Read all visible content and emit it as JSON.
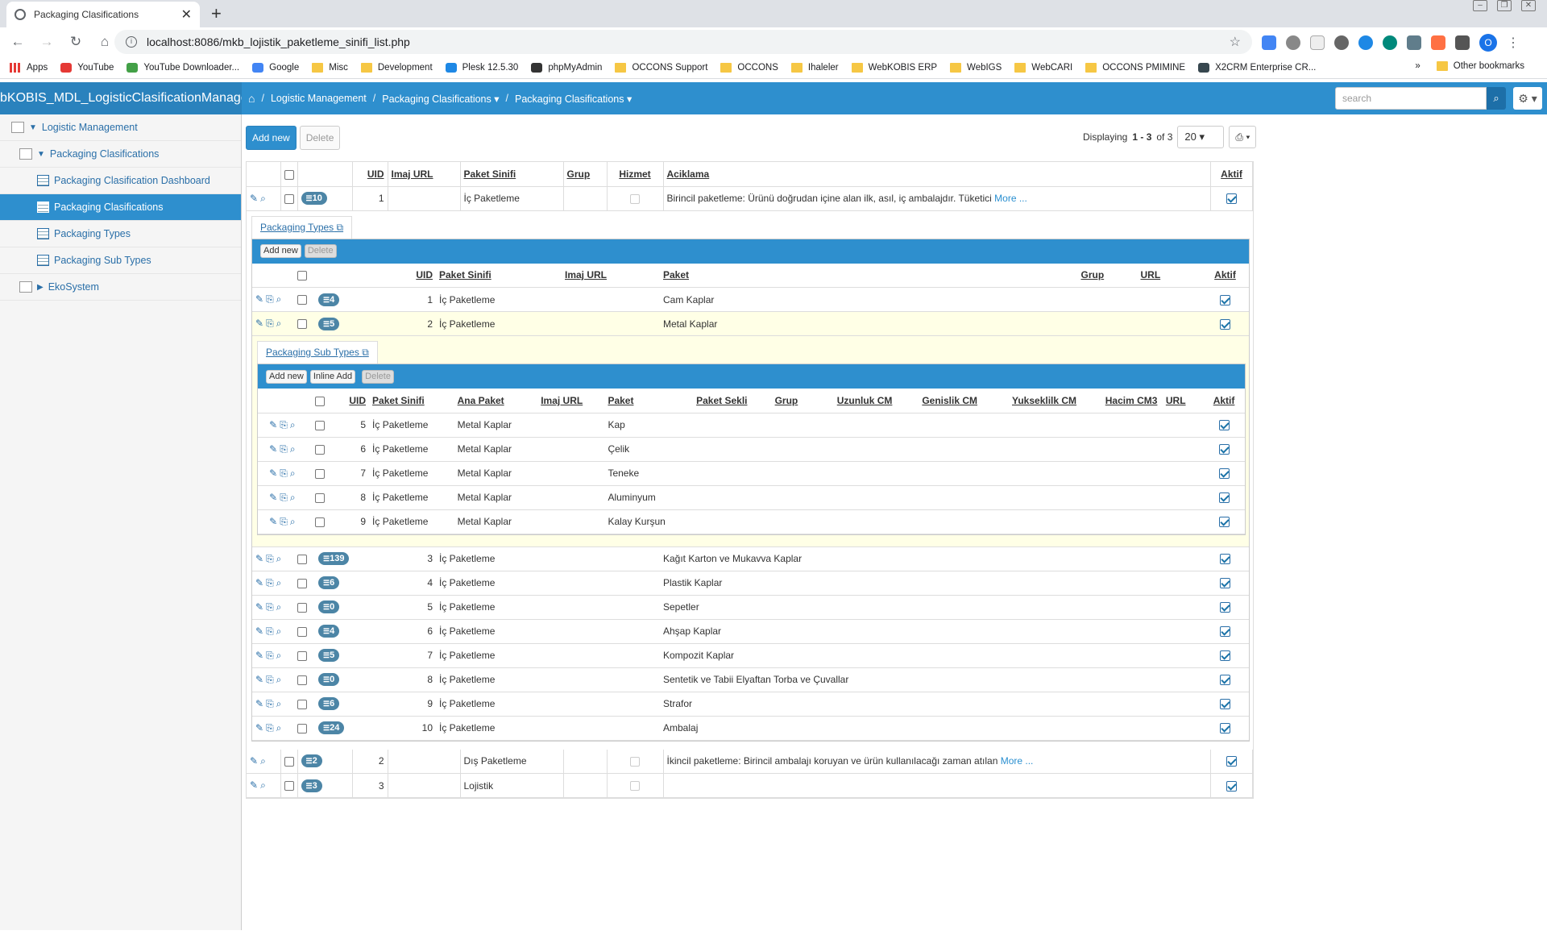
{
  "browser": {
    "tab_title": "Packaging Clasifications",
    "url": "localhost:8086/mkb_lojistik_paketleme_sinifi_list.php",
    "profile_initial": "O",
    "bookmarks": [
      "Apps",
      "YouTube",
      "YouTube Downloader...",
      "Google",
      "Misc",
      "Development",
      "Plesk 12.5.30",
      "phpMyAdmin",
      "OCCONS Support",
      "OCCONS",
      "Ihaleler",
      "WebKOBIS ERP",
      "WebIGS",
      "WebCARI",
      "OCCONS PMIMINE",
      "X2CRM Enterprise CR..."
    ],
    "more_bookmarks": "»",
    "other_bookmarks": "Other bookmarks"
  },
  "app": {
    "brand": "bKOBIS_MDL_LogisticClasificationManagem",
    "breadcrumbs": [
      "Logistic Management",
      "Packaging Clasifications",
      "Packaging Clasifications"
    ],
    "search_placeholder": "search"
  },
  "sidebar": {
    "items": [
      "Logistic Management",
      "Packaging Clasifications",
      "Packaging Clasification Dashboard",
      "Packaging Clasifications",
      "Packaging Types",
      "Packaging Sub Types",
      "EkoSystem"
    ]
  },
  "toolbar": {
    "add_new": "Add new",
    "delete": "Delete",
    "displaying_prefix": "Displaying",
    "range": "1 - 3",
    "of": "of 3",
    "page_size": "20"
  },
  "main_headers": [
    "UID",
    "Imaj URL",
    "Paket Sinifi",
    "Grup",
    "Hizmet",
    "Aciklama",
    "Aktif"
  ],
  "main_rows": [
    {
      "badge": "10",
      "uid": "1",
      "sinif": "İç Paketleme",
      "aciklama": "Birincil paketleme: Ürünü doğrudan içine alan ilk, asıl, iç ambalajdır. Tüketici",
      "more": "More ..."
    },
    {
      "badge": "2",
      "uid": "2",
      "sinif": "Dış Paketleme",
      "aciklama": "İkincil paketleme: Birincil ambalajı koruyan ve ürün kullanılacağı zaman atılan",
      "more": "More ..."
    },
    {
      "badge": "3",
      "uid": "3",
      "sinif": "Lojistik",
      "aciklama": "",
      "more": ""
    }
  ],
  "types": {
    "tab": "Packaging Types",
    "add_new": "Add new",
    "delete": "Delete",
    "headers": [
      "UID",
      "Paket Sinifi",
      "Imaj URL",
      "Paket",
      "Grup",
      "URL",
      "Aktif"
    ],
    "rows": [
      {
        "badge": "4",
        "uid": "1",
        "sinif": "İç Paketleme",
        "paket": "Cam Kaplar"
      },
      {
        "badge": "5",
        "uid": "2",
        "sinif": "İç Paketleme",
        "paket": "Metal Kaplar"
      },
      {
        "badge": "139",
        "uid": "3",
        "sinif": "İç Paketleme",
        "paket": "Kağıt Karton ve Mukavva Kaplar"
      },
      {
        "badge": "6",
        "uid": "4",
        "sinif": "İç Paketleme",
        "paket": "Plastik Kaplar"
      },
      {
        "badge": "0",
        "uid": "5",
        "sinif": "İç Paketleme",
        "paket": "Sepetler"
      },
      {
        "badge": "4",
        "uid": "6",
        "sinif": "İç Paketleme",
        "paket": "Ahşap Kaplar"
      },
      {
        "badge": "5",
        "uid": "7",
        "sinif": "İç Paketleme",
        "paket": "Kompozit Kaplar"
      },
      {
        "badge": "0",
        "uid": "8",
        "sinif": "İç Paketleme",
        "paket": "Sentetik ve Tabii Elyaftan Torba ve Çuvallar"
      },
      {
        "badge": "6",
        "uid": "9",
        "sinif": "İç Paketleme",
        "paket": "Strafor"
      },
      {
        "badge": "24",
        "uid": "10",
        "sinif": "İç Paketleme",
        "paket": "Ambalaj"
      }
    ]
  },
  "subtypes": {
    "tab": "Packaging Sub Types",
    "add_new": "Add new",
    "inline_add": "Inline Add",
    "delete": "Delete",
    "headers": [
      "UID",
      "Paket Sinifi",
      "Ana Paket",
      "Imaj URL",
      "Paket",
      "Paket Sekli",
      "Grup",
      "Uzunluk CM",
      "Genislik CM",
      "Yukseklilk CM",
      "Hacim CM3",
      "URL",
      "Aktif"
    ],
    "rows": [
      {
        "uid": "5",
        "sinif": "İç Paketleme",
        "ana": "Metal Kaplar",
        "paket": "Kap"
      },
      {
        "uid": "6",
        "sinif": "İç Paketleme",
        "ana": "Metal Kaplar",
        "paket": "Çelik"
      },
      {
        "uid": "7",
        "sinif": "İç Paketleme",
        "ana": "Metal Kaplar",
        "paket": "Teneke"
      },
      {
        "uid": "8",
        "sinif": "İç Paketleme",
        "ana": "Metal Kaplar",
        "paket": "Aluminyum"
      },
      {
        "uid": "9",
        "sinif": "İç Paketleme",
        "ana": "Metal Kaplar",
        "paket": "Kalay Kurşun"
      }
    ]
  }
}
